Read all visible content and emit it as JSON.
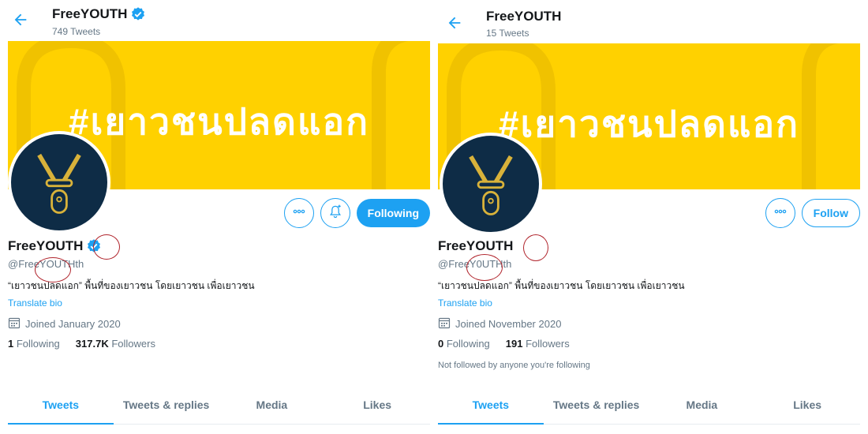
{
  "left": {
    "top_name": "FreeYOUTH",
    "tweet_count": "749 Tweets",
    "banner_text": "#เยาวชนปลดแอก",
    "button_label": "Following",
    "name": "FreeYOUTH",
    "handle": "@FreeYOUTHth",
    "bio": "“เยาวชนปลดแอก” พื้นที่ของเยาวชน โดยเยาวชน เพื่อเยาวชน",
    "translate": "Translate bio",
    "joined": "Joined January 2020",
    "following_count": "1",
    "following_label": "Following",
    "followers_count": "317.7K",
    "followers_label": "Followers",
    "tabs": [
      "Tweets",
      "Tweets & replies",
      "Media",
      "Likes"
    ]
  },
  "right": {
    "top_name": "FreeYOUTH",
    "tweet_count": "15 Tweets",
    "banner_text": "#เยาวชนปลดแอก",
    "button_label": "Follow",
    "name": "FreeYOUTH",
    "handle": "@FreeY0UTHth",
    "bio": "“เยาวชนปลดแอก” พื้นที่ของเยาวชน โดยเยาวชน เพื่อเยาวชน",
    "translate": "Translate bio",
    "joined": "Joined November 2020",
    "following_count": "0",
    "following_label": "Following",
    "followers_count": "191",
    "followers_label": "Followers",
    "not_followed": "Not followed by anyone you're following",
    "tabs": [
      "Tweets",
      "Tweets & replies",
      "Media",
      "Likes"
    ]
  },
  "colors": {
    "accent": "#1da1f2",
    "banner": "#ffd100",
    "avatar_bg": "#0e2c46",
    "annotation": "#b0242c"
  },
  "icons": [
    "back-arrow-icon",
    "verified-badge-icon",
    "more-icon",
    "notification-bell-icon",
    "calendar-icon",
    "logo-icon"
  ]
}
